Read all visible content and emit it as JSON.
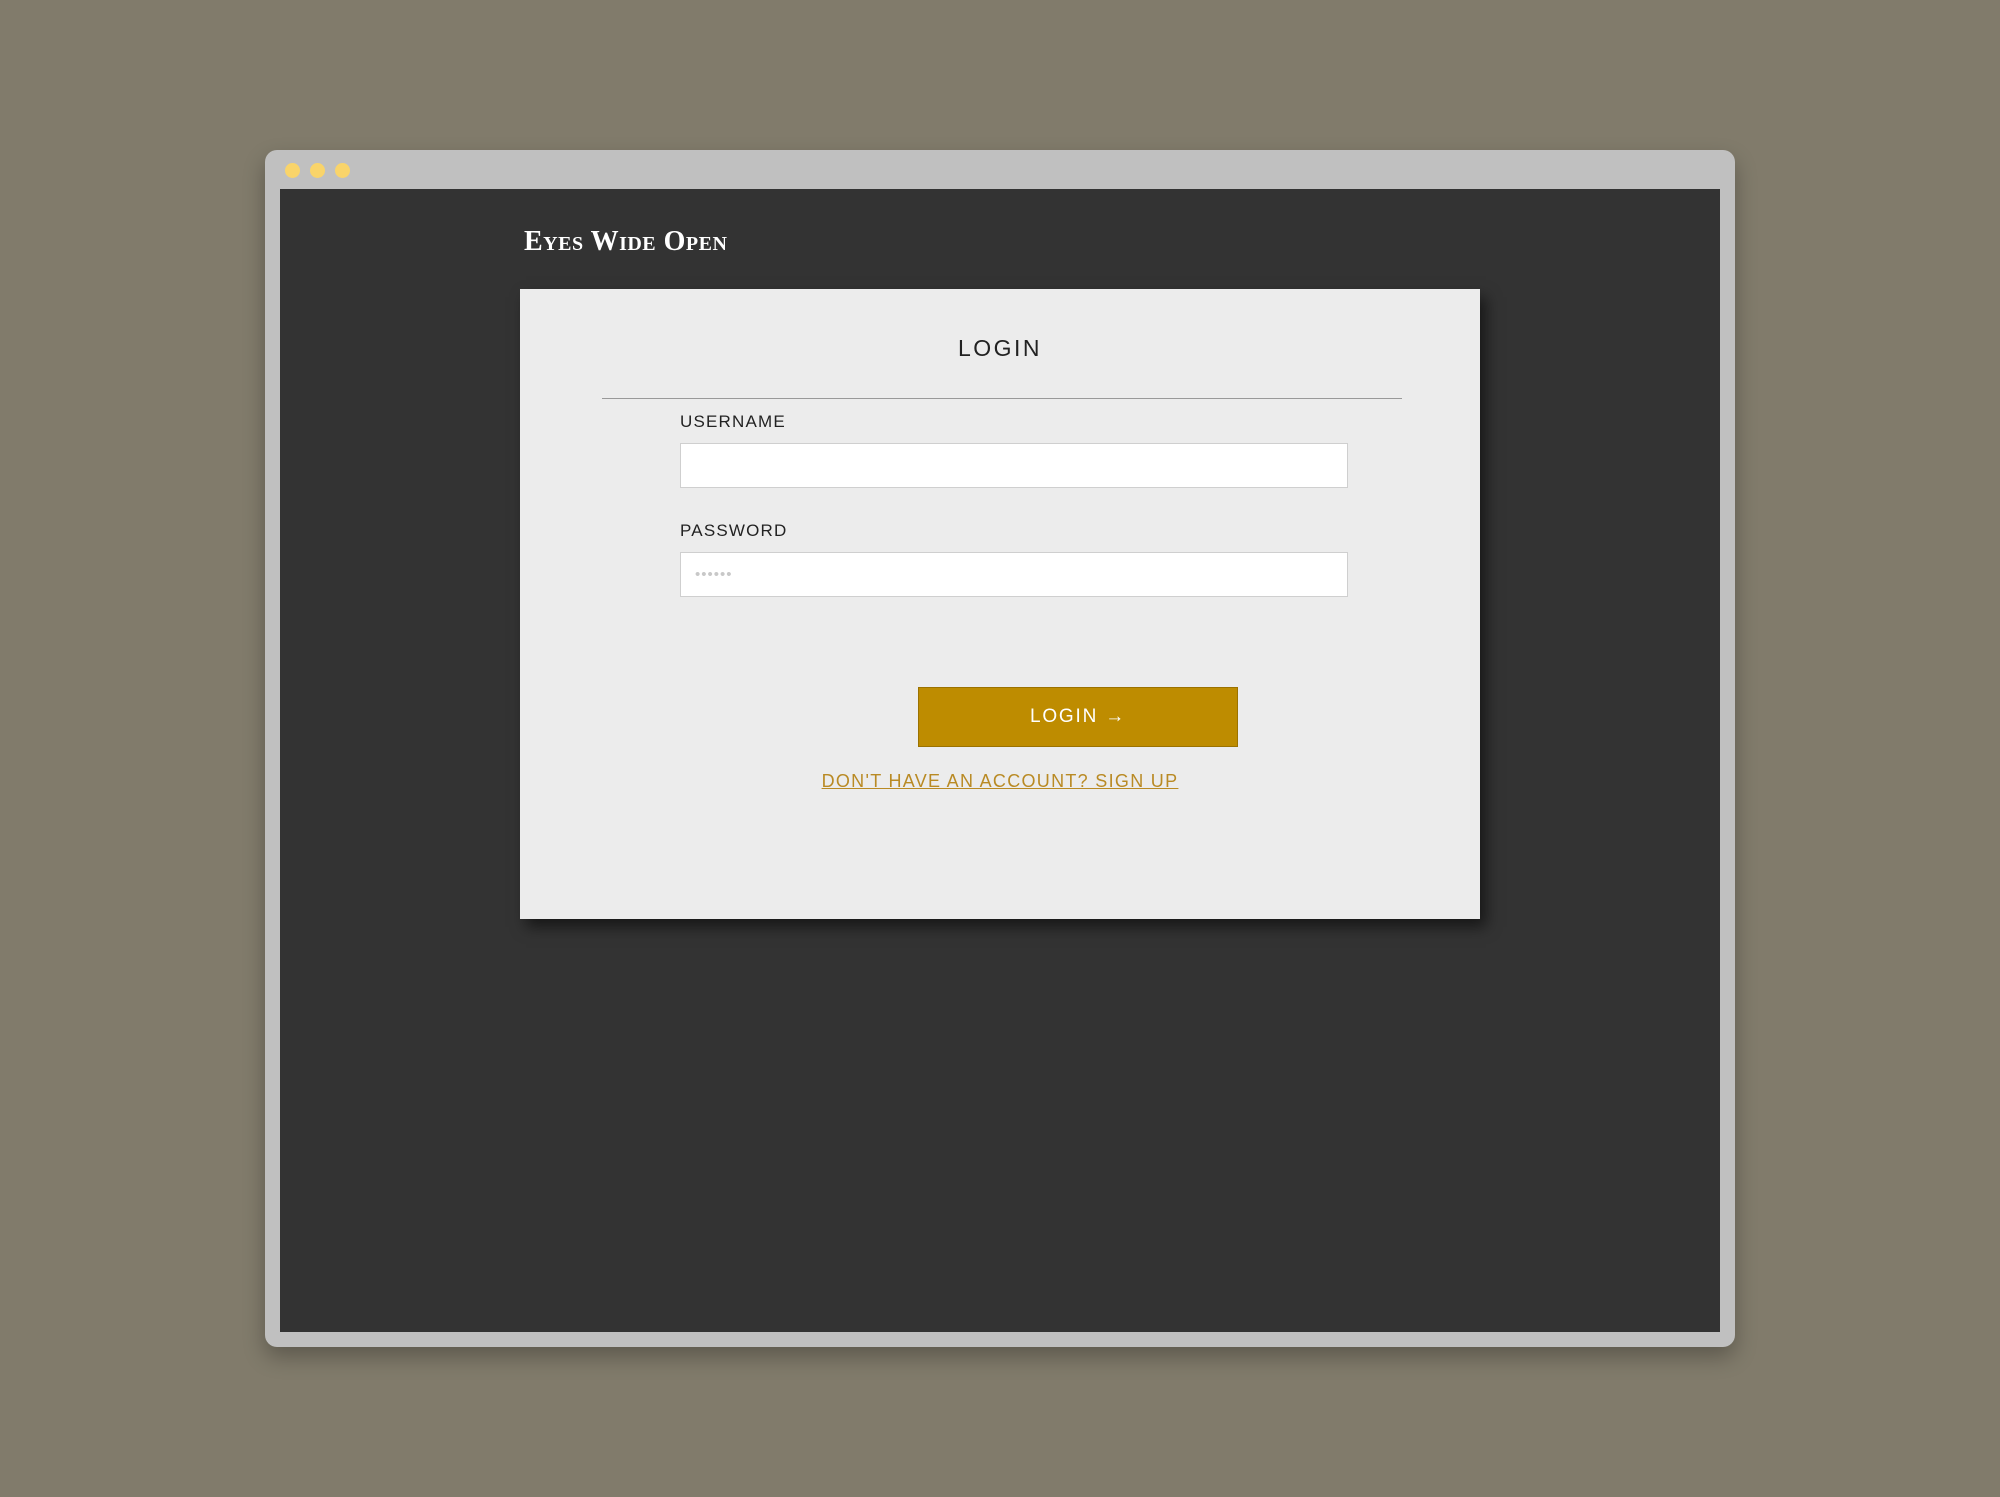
{
  "brand": {
    "title": "Eyes Wide Open"
  },
  "login": {
    "title": "LOGIN",
    "username_label": "USERNAME",
    "username_value": "",
    "password_label": "PASSWORD",
    "password_placeholder": "••••••",
    "submit_label": "LOGIN →",
    "signup_link": "DON'T HAVE AN ACCOUNT? SIGN UP"
  },
  "colors": {
    "desktop": "#817b6b",
    "viewport": "#333333",
    "card": "#ececec",
    "accent": "#be8c00",
    "link": "#b98a24"
  }
}
